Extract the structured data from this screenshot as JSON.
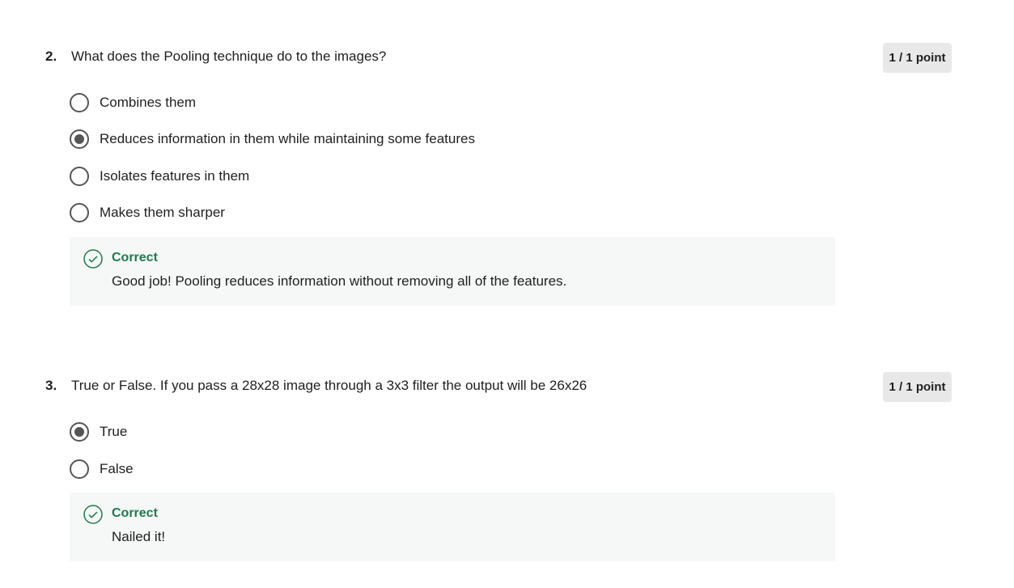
{
  "questions": [
    {
      "number": "2.",
      "text": "What does the Pooling technique do to the images?",
      "points": "1 / 1 point",
      "options": [
        {
          "label": "Combines them",
          "selected": false
        },
        {
          "label": "Reduces information in them while maintaining some features",
          "selected": true
        },
        {
          "label": "Isolates features in them",
          "selected": false
        },
        {
          "label": "Makes them sharper",
          "selected": false
        }
      ],
      "feedback": {
        "status": "Correct",
        "message": "Good job! Pooling reduces information without removing all of the features.",
        "icon": "check-circle-icon",
        "color": "#1f7a4d"
      }
    },
    {
      "number": "3.",
      "text": "True or  False. If you pass a 28x28 image through a 3x3 filter the output will be 26x26",
      "points": "1 / 1 point",
      "options": [
        {
          "label": "True",
          "selected": true
        },
        {
          "label": "False",
          "selected": false
        }
      ],
      "feedback": {
        "status": "Correct",
        "message": "Nailed it!",
        "icon": "check-circle-icon",
        "color": "#1f7a4d"
      }
    }
  ]
}
